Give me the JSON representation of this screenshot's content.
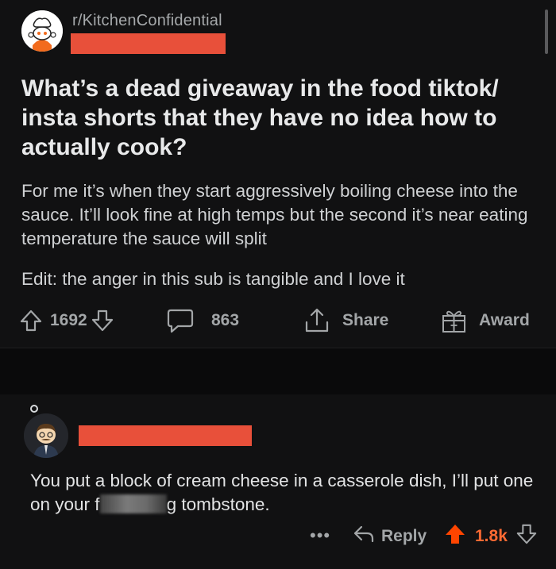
{
  "post": {
    "subreddit": "r/KitchenConfidential",
    "title": "What’s a dead giveaway in the food tiktok/ insta shorts that they have no idea how to actually cook?",
    "body": "For me it’s when they start aggressively boiling cheese into the sauce. It’ll look fine at high temps but the second it’s near eating temperature the sauce will split",
    "edit": "Edit: the anger in this sub is tangible and I love it",
    "votes": "1692",
    "comments": "863",
    "share_label": "Share",
    "award_label": "Award"
  },
  "comment": {
    "text_before": "You put a block of cream cheese in a casserole dish, I’ll put one on your f",
    "text_after": "g tombstone.",
    "more_label": "•••",
    "reply_label": "Reply",
    "votes": "1.8k"
  },
  "colors": {
    "background": "#111112",
    "redaction": "#e8503a",
    "upvote_active": "#ff4500",
    "upvote_count": "#ff6a33",
    "muted_text": "#a3a6a8"
  },
  "icons": [
    "subreddit-chef-avatar",
    "upvote-icon",
    "downvote-icon",
    "comment-icon",
    "share-icon",
    "award-icon",
    "user-avatar",
    "reply-icon"
  ]
}
